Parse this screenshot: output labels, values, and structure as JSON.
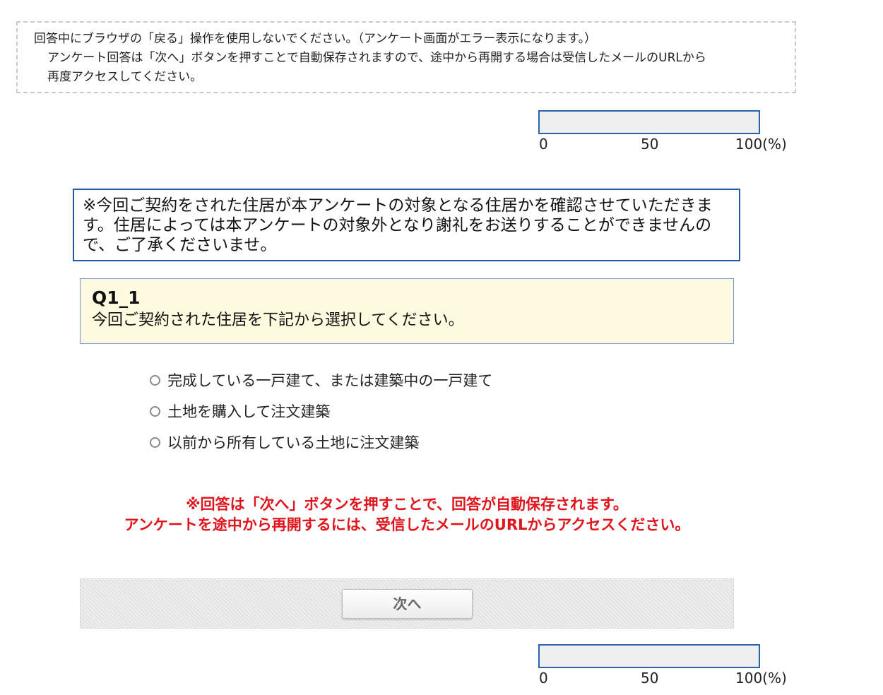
{
  "notice": {
    "line1": "回答中にブラウザの「戻る」操作を使用しないでください。（アンケート画面がエラー表示になります。）",
    "line2": "アンケート回答は「次へ」ボタンを押すことで自動保存されますので、途中から再開する場合は受信したメールのURLから",
    "line3": "再度アクセスしてください。"
  },
  "progress": {
    "value_percent": 0,
    "labels": [
      "0",
      "50",
      "100(%)"
    ]
  },
  "info_box": {
    "text": "※今回ご契約をされた住居が本アンケートの対象となる住居かを確認させていただきます。住居によっては本アンケートの対象外となり謝礼をお送りすることができませんので、ご了承くださいませ。"
  },
  "question": {
    "id": "Q1_1",
    "text": "今回ご契約された住居を下記から選択してください。",
    "options": [
      {
        "label": "完成している一戸建て、または建築中の一戸建て",
        "selected": false
      },
      {
        "label": "土地を購入して注文建築",
        "selected": false
      },
      {
        "label": "以前から所有している土地に注文建築",
        "selected": false
      }
    ]
  },
  "warning": {
    "line1": "※回答は「次へ」ボタンを押すことで、回答が自動保存されます。",
    "line2": "アンケートを途中から再開するには、受信したメールのURLからアクセスください。"
  },
  "nav": {
    "next_label": "次へ"
  },
  "colors": {
    "accent": "#2f63a8",
    "warning": "#e0141b",
    "question_bg": "#fffbe0"
  }
}
